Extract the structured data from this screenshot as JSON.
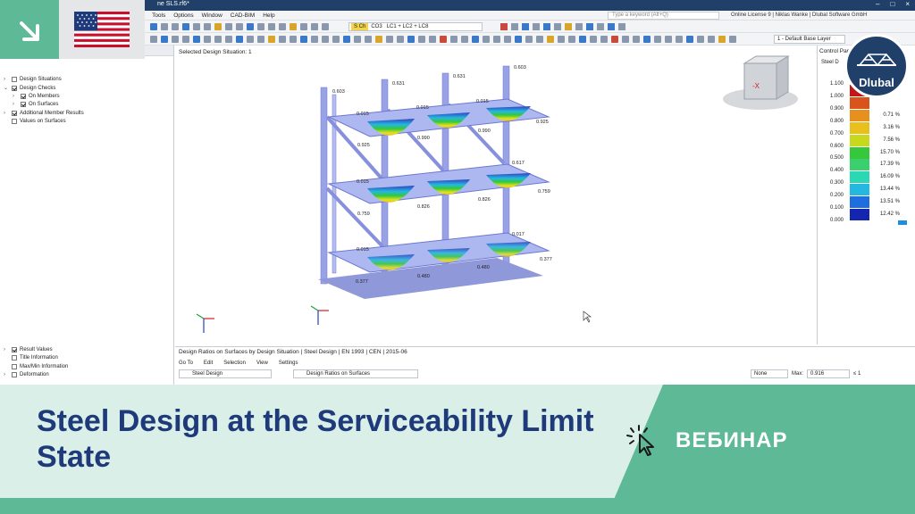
{
  "window": {
    "title": "ne SLS.rf6*",
    "menu": [
      "ts",
      "Tools",
      "Options",
      "Window",
      "CAD-BIM",
      "Help"
    ],
    "search_placeholder": "Type a keyword (Alt+Q)",
    "license": "Online License 9 | Niklas Wanke | Dlubal Software GmbH"
  },
  "toolbar": {
    "load_tag": "S Ch",
    "load_case": "CO3",
    "load_combo": "LC1 + LC2 + LC8",
    "layer": "1 - Default Base Layer"
  },
  "navigator": {
    "title": "Steel Design",
    "items": [
      {
        "label": "Design Situations",
        "checked": false,
        "indent": 0
      },
      {
        "label": "Design Checks",
        "checked": true,
        "indent": 0
      },
      {
        "label": "On Members",
        "checked": true,
        "indent": 1
      },
      {
        "label": "On Surfaces",
        "checked": true,
        "indent": 1
      },
      {
        "label": "Additional Member Results",
        "checked": true,
        "indent": 0
      },
      {
        "label": "Values on Surfaces",
        "checked": false,
        "indent": 0
      }
    ],
    "bottom_items": [
      {
        "label": "Result Values",
        "checked": true
      },
      {
        "label": "Title Information",
        "checked": false
      },
      {
        "label": "Max/Min Information",
        "checked": false
      },
      {
        "label": "Deformation",
        "checked": false
      }
    ]
  },
  "viewport": {
    "title": "Selected Design Situation: 1",
    "values": [
      "0.603",
      "0.631",
      "0.631",
      "0.603",
      "0.015",
      "0.015",
      "0.015",
      "0.925",
      "0.990",
      "0.990",
      "0.925",
      "0.015",
      "0.617",
      "0.759",
      "0.826",
      "0.826",
      "0.759",
      "0.015",
      "0.017",
      "0.377",
      "0.480",
      "0.480",
      "0.377"
    ]
  },
  "control_panel": {
    "title": "Control Pan",
    "subtitle": "Steel D",
    "legend": [
      {
        "value": "1.100",
        "color": "#c01818",
        "percent": ""
      },
      {
        "value": "1.000",
        "color": "#d8541c",
        "percent": ""
      },
      {
        "value": "0.900",
        "color": "#e8901e",
        "percent": "0.71 %"
      },
      {
        "value": "0.800",
        "color": "#e8c01e",
        "percent": "3.16 %"
      },
      {
        "value": "0.700",
        "color": "#c8d81e",
        "percent": "7.56 %"
      },
      {
        "value": "0.600",
        "color": "#34c83a",
        "percent": "15.70 %"
      },
      {
        "value": "0.500",
        "color": "#3ad06e",
        "percent": "17.39 %"
      },
      {
        "value": "0.400",
        "color": "#2ad8b4",
        "percent": "16.09 %"
      },
      {
        "value": "0.300",
        "color": "#24b8e0",
        "percent": "13.44 %"
      },
      {
        "value": "0.200",
        "color": "#1e6ee0",
        "percent": "13.51 %"
      },
      {
        "value": "0.100",
        "color": "#1426b0",
        "percent": "12.42 %"
      },
      {
        "value": "0.000",
        "color": "",
        "percent": ""
      }
    ]
  },
  "table_panel": {
    "title": "Design Ratios on Surfaces by Design Situation | Steel Design | EN 1993 | CEN | 2015-06",
    "menu": [
      "Go To",
      "Edit",
      "Selection",
      "View",
      "Settings"
    ],
    "module": "Steel Design",
    "result": "Design Ratios on Surfaces",
    "filter": "None",
    "max_label": "Max:",
    "max_value": "0.916",
    "max_cmp": "≤ 1"
  },
  "banner": {
    "headline": "Steel Design at the Serviceability Limit State",
    "tag": "ВЕБИНАР",
    "brand": "Dlubal",
    "colors": {
      "mint": "#d9efe7",
      "green": "#5db996",
      "navy": "#1f3a7a"
    }
  }
}
